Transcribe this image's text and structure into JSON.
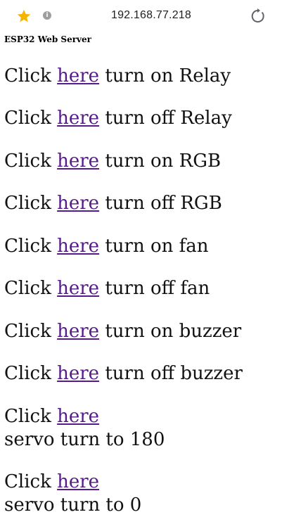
{
  "browser": {
    "url": "192.168.77.218",
    "star_icon": "star-icon",
    "info_icon": "info-icon",
    "reload_icon": "reload-icon",
    "star_color": "#f4b400"
  },
  "page": {
    "title": "ESP32 Web Server",
    "link_color": "#551a8b",
    "items": [
      {
        "prefix": "Click ",
        "link": "here",
        "suffix": " turn on Relay"
      },
      {
        "prefix": "Click ",
        "link": "here",
        "suffix": " turn off Relay"
      },
      {
        "prefix": "Click ",
        "link": "here",
        "suffix": " turn on RGB"
      },
      {
        "prefix": "Click ",
        "link": "here",
        "suffix": " turn off RGB"
      },
      {
        "prefix": "Click ",
        "link": "here",
        "suffix": " turn on fan"
      },
      {
        "prefix": "Click ",
        "link": "here",
        "suffix": " turn off fan"
      },
      {
        "prefix": "Click ",
        "link": "here",
        "suffix": " turn on buzzer"
      },
      {
        "prefix": "Click ",
        "link": "here",
        "suffix": " turn off buzzer"
      },
      {
        "prefix": "Click ",
        "link": "here",
        "suffix": "servo turn to 180"
      },
      {
        "prefix": "Click ",
        "link": "here",
        "suffix": "servo turn to 0"
      }
    ]
  }
}
